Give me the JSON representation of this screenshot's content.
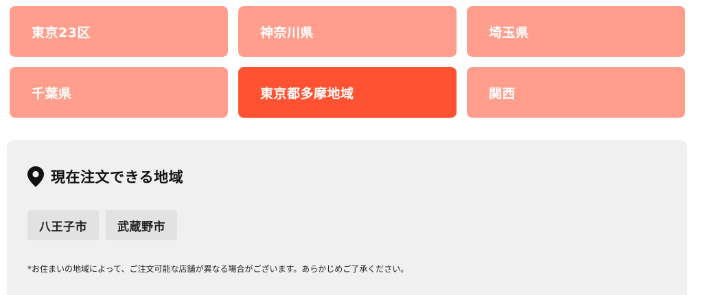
{
  "regions": [
    {
      "label": "東京23区",
      "active": false
    },
    {
      "label": "神奈川県",
      "active": false
    },
    {
      "label": "埼玉県",
      "active": false
    },
    {
      "label": "千葉県",
      "active": false
    },
    {
      "label": "東京都多摩地域",
      "active": true
    },
    {
      "label": "関西",
      "active": false
    }
  ],
  "panel": {
    "heading": "現在注文できる地域",
    "heading_icon": "map-pin-icon",
    "areas": [
      "八王子市",
      "武蔵野市"
    ],
    "note": "*お住まいの地域によって、ご注文可能な店舗が異なる場合がございます。あらかじめご了承ください。"
  },
  "colors": {
    "region_default": "#ff9e8c",
    "region_active": "#ff5232",
    "panel_bg": "#f0f0f0",
    "chip_bg": "#e2e2e2"
  }
}
